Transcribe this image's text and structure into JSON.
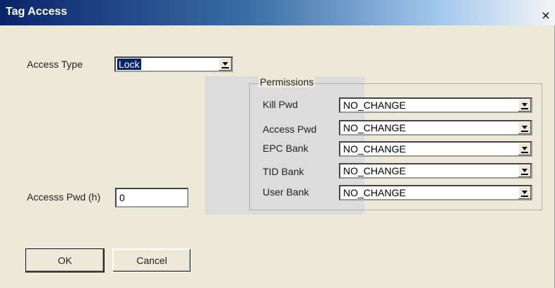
{
  "window": {
    "title": "Tag Access",
    "close_glyph": "×"
  },
  "access_type": {
    "label": "Access Type",
    "value": "Lock"
  },
  "access_pwd": {
    "label": "Accesss Pwd (h)",
    "value": "0"
  },
  "permissions": {
    "legend": "Permissions",
    "rows": [
      {
        "label": "Kill Pwd",
        "value": "NO_CHANGE"
      },
      {
        "label": "Access Pwd",
        "value": "NO_CHANGE"
      },
      {
        "label": "EPC Bank",
        "value": "NO_CHANGE"
      },
      {
        "label": "TID Bank",
        "value": "NO_CHANGE"
      },
      {
        "label": "User Bank",
        "value": "NO_CHANGE"
      }
    ]
  },
  "buttons": {
    "ok_label": "OK",
    "cancel_label": "Cancel"
  },
  "icons": {
    "close": "close-icon",
    "dropdown": "chevron-down-icon"
  }
}
